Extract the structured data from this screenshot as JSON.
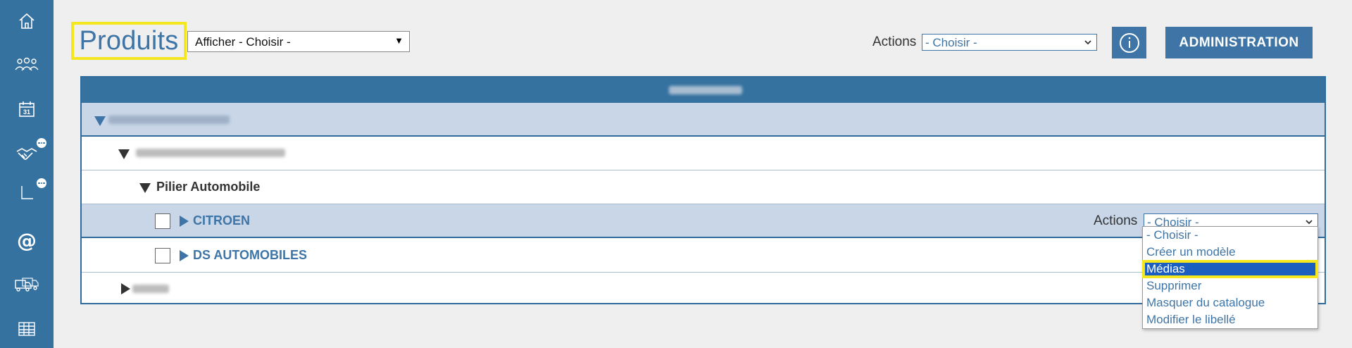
{
  "page": {
    "title": "Produits",
    "afficher_select_value": "Afficher - Choisir -",
    "afficher_caret": "▼"
  },
  "header_actions": {
    "label": "Actions",
    "select_value": "- Choisir -",
    "admin_label": "ADMINISTRATION"
  },
  "sidebar": {
    "items": [
      {
        "icon": "home-icon"
      },
      {
        "icon": "people-group-icon"
      },
      {
        "icon": "calendar-icon",
        "text": "31"
      },
      {
        "icon": "handshake-icon",
        "badge": true
      },
      {
        "icon": "chart-axis-icon",
        "badge": true
      },
      {
        "icon": "at-icon",
        "text": "@"
      },
      {
        "icon": "trucks-icon"
      },
      {
        "icon": "table-icon"
      }
    ]
  },
  "tree": {
    "rows": [
      {
        "level": 0,
        "expanded": true,
        "label": "",
        "redacted": true
      },
      {
        "level": 1,
        "expanded": true,
        "label": "",
        "redacted": true
      },
      {
        "level": 2,
        "expanded": true,
        "label": "Pilier Automobile"
      },
      {
        "level": 3,
        "expanded": false,
        "label": "CITROEN",
        "checkbox": true,
        "selected": true
      },
      {
        "level": 3,
        "expanded": false,
        "label": "DS AUTOMOBILES",
        "checkbox": true
      },
      {
        "level": 1,
        "expanded": false,
        "label": "",
        "redacted": true
      }
    ],
    "row_actions": {
      "label": "Actions",
      "select_value": "- Choisir -"
    }
  },
  "dropdown": {
    "options": [
      "- Choisir -",
      "Créer un modèle",
      "Médias",
      "Supprimer",
      "Masquer du catalogue",
      "Modifier le libellé"
    ],
    "selected_index": 2
  },
  "colors": {
    "brand_blue": "#3572a0",
    "highlight_yellow": "#f4e71f",
    "selection_blue": "#1a5fc0"
  }
}
